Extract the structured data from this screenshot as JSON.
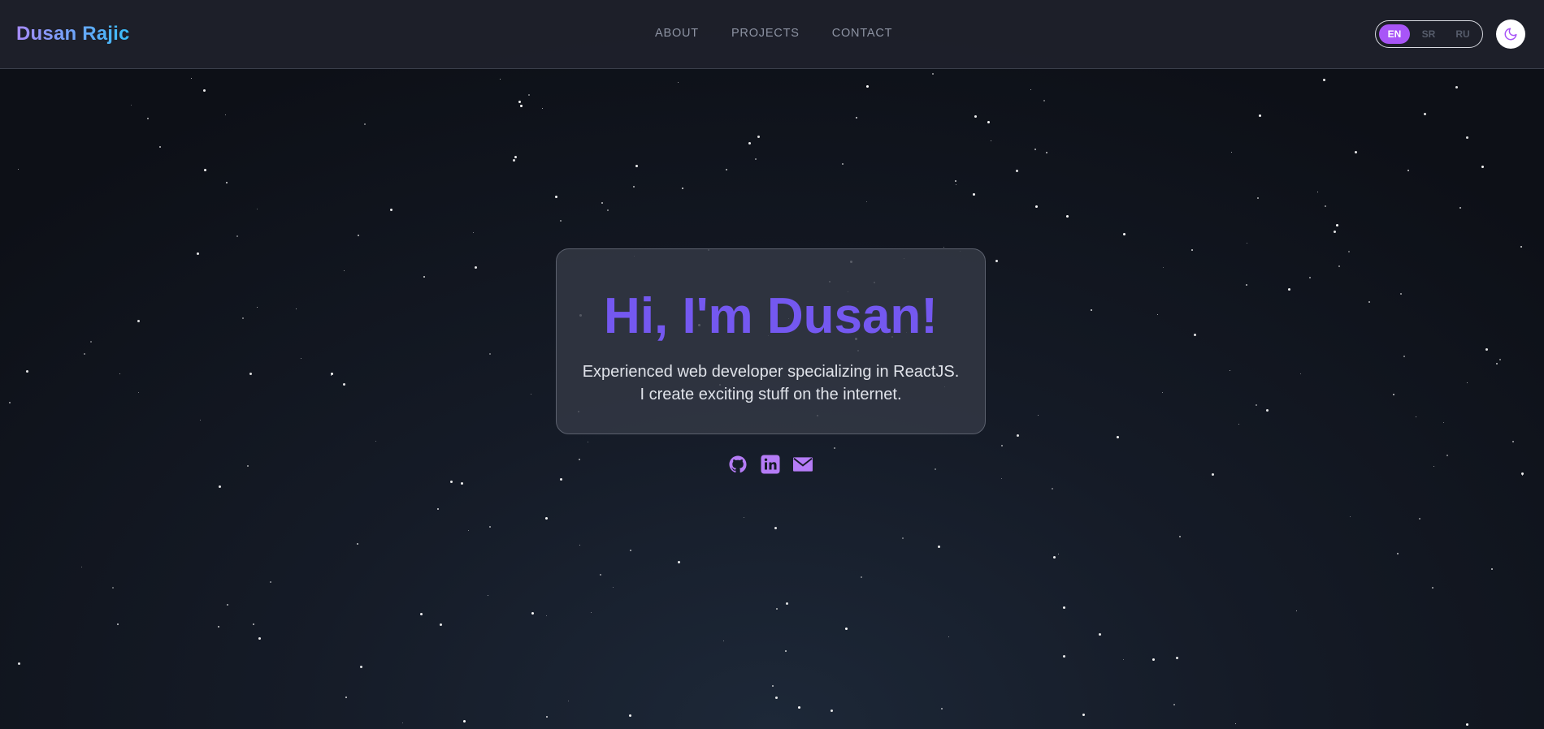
{
  "header": {
    "logo": "Dusan Rajic",
    "nav": [
      {
        "label": "ABOUT"
      },
      {
        "label": "PROJECTS"
      },
      {
        "label": "CONTACT"
      }
    ],
    "languages": [
      {
        "code": "EN",
        "active": true
      },
      {
        "code": "SR",
        "active": false
      },
      {
        "code": "RU",
        "active": false
      }
    ],
    "theme_toggle_icon": "moon-icon"
  },
  "hero": {
    "title": "Hi, I'm Dusan!",
    "subtitle_line1": "Experienced web developer specializing in ReactJS.",
    "subtitle_line2": "I create exciting stuff on the internet."
  },
  "socials": [
    {
      "icon": "github-icon"
    },
    {
      "icon": "linkedin-icon"
    },
    {
      "icon": "email-icon"
    }
  ],
  "colors": {
    "accent": "#a855f7",
    "title": "#7458f0",
    "logo_gradient_start": "#a78bfa",
    "logo_gradient_end": "#38bdf8",
    "background": "#151b27"
  }
}
